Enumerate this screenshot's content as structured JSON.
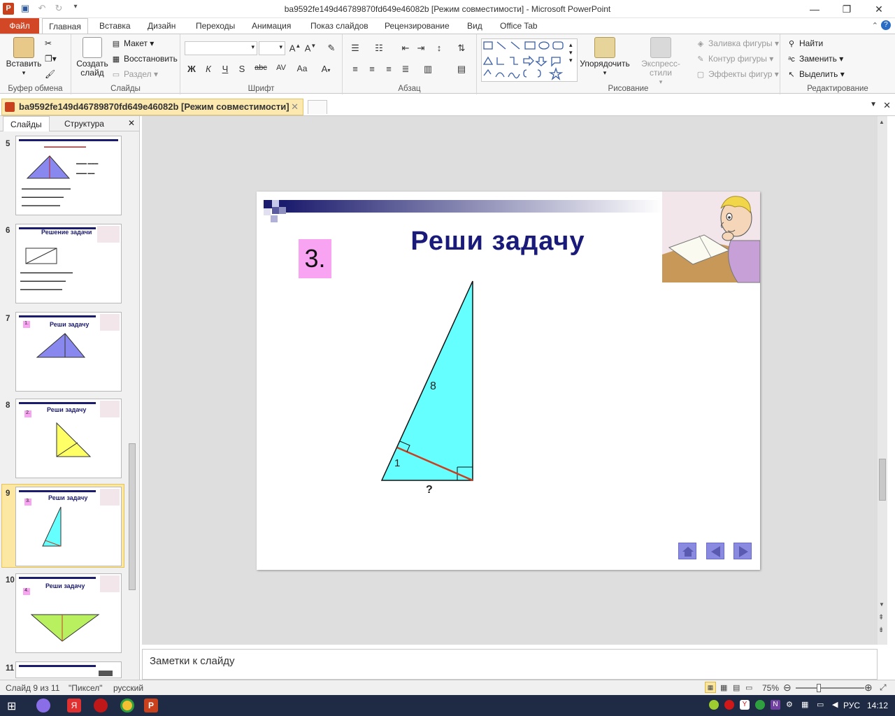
{
  "window": {
    "title": "ba9592fe149d46789870fd649e46082b [Режим совместимости] - Microsoft PowerPoint",
    "app_icon": "P"
  },
  "tabs": [
    "Файл",
    "Главная",
    "Вставка",
    "Дизайн",
    "Переходы",
    "Анимация",
    "Показ слайдов",
    "Рецензирование",
    "Вид",
    "Office Tab"
  ],
  "ribbon": {
    "clipboard": {
      "label": "Буфер обмена",
      "paste": "Вставить"
    },
    "slides": {
      "label": "Слайды",
      "create": "Создать слайд",
      "layout": "Макет",
      "restore": "Восстановить",
      "section": "Раздел"
    },
    "font": {
      "label": "Шрифт",
      "bold": "Ж",
      "italic": "К",
      "underline": "Ч",
      "shadow": "S",
      "strike": "abc",
      "spacing": "AV",
      "case": "Аа"
    },
    "paragraph": {
      "label": "Абзац"
    },
    "drawing": {
      "label": "Рисование",
      "arrange": "Упорядочить",
      "quick_styles": "Экспресс-стили",
      "fill": "Заливка фигуры",
      "outline": "Контур фигуры",
      "effects": "Эффекты фигур"
    },
    "editing": {
      "label": "Редактирование",
      "find": "Найти",
      "replace": "Заменить",
      "select": "Выделить"
    }
  },
  "doc_tab": {
    "title": "ba9592fe149d46789870fd649e46082b [Режим совместимости]",
    "close": "✕"
  },
  "left_pane": {
    "tab_slides": "Слайды",
    "tab_outline": "Структура",
    "close": "✕",
    "thumbs": [
      {
        "num": "5",
        "title": ""
      },
      {
        "num": "6",
        "title": "Решение задачи"
      },
      {
        "num": "7",
        "title": "Реши задачу",
        "badge": "1."
      },
      {
        "num": "8",
        "title": "Реши задачу",
        "badge": "2."
      },
      {
        "num": "9",
        "title": "Реши задачу",
        "badge": "3."
      },
      {
        "num": "10",
        "title": "Реши задачу",
        "badge": "4."
      },
      {
        "num": "11",
        "title": ""
      }
    ]
  },
  "slide": {
    "title": "Реши задачу",
    "number": "3.",
    "label_side": "8",
    "label_angle": "1",
    "label_unknown": "?"
  },
  "notes_placeholder": "Заметки к слайду",
  "status": {
    "slide_info": "Слайд 9 из 11",
    "theme": "\"Пиксел\"",
    "language": "русский",
    "zoom": "75%"
  },
  "taskbar": {
    "lang": "РУС",
    "time": "14:12"
  }
}
